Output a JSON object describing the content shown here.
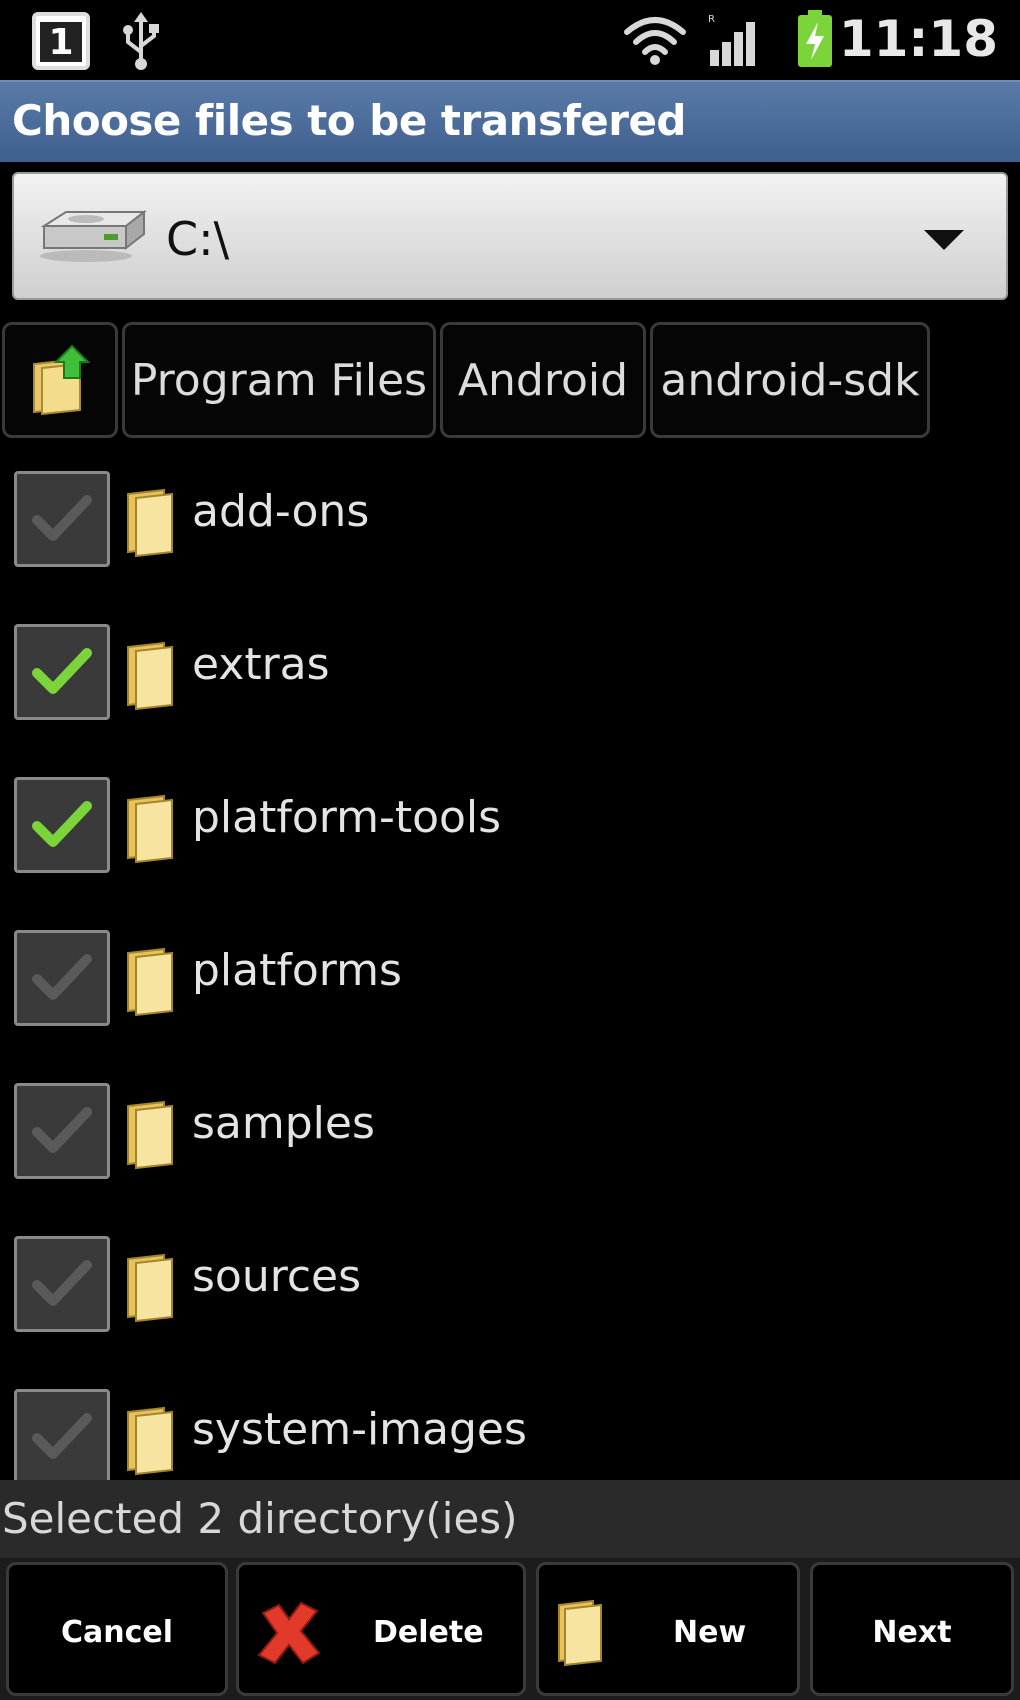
{
  "status_bar": {
    "time": "11:18",
    "sim_label": "1",
    "icons": [
      "sim-icon",
      "usb-icon",
      "wifi-icon",
      "signal-icon",
      "battery-charging-icon"
    ]
  },
  "title_bar": {
    "title": "Choose files to be transfered"
  },
  "drive_selector": {
    "value": "C:\\",
    "icon": "hard-drive-icon"
  },
  "breadcrumb": {
    "up_icon": "folder-up-icon",
    "items": [
      {
        "label": "Program Files"
      },
      {
        "label": "Android"
      },
      {
        "label": "android-sdk"
      }
    ]
  },
  "file_list": {
    "items": [
      {
        "name": "add-ons",
        "checked": false
      },
      {
        "name": "extras",
        "checked": true
      },
      {
        "name": "platform-tools",
        "checked": true
      },
      {
        "name": "platforms",
        "checked": false
      },
      {
        "name": "samples",
        "checked": false
      },
      {
        "name": "sources",
        "checked": false
      },
      {
        "name": "system-images",
        "checked": false
      }
    ]
  },
  "selection": {
    "text": "Selected  2 directory(ies)"
  },
  "buttons": {
    "cancel": "Cancel",
    "delete": "Delete",
    "new": "New",
    "next": "Next"
  },
  "colors": {
    "title_bar": "#4a6b9a",
    "check_on": "#7bd43a",
    "check_off": "#5a5a5a",
    "background": "#000000"
  }
}
